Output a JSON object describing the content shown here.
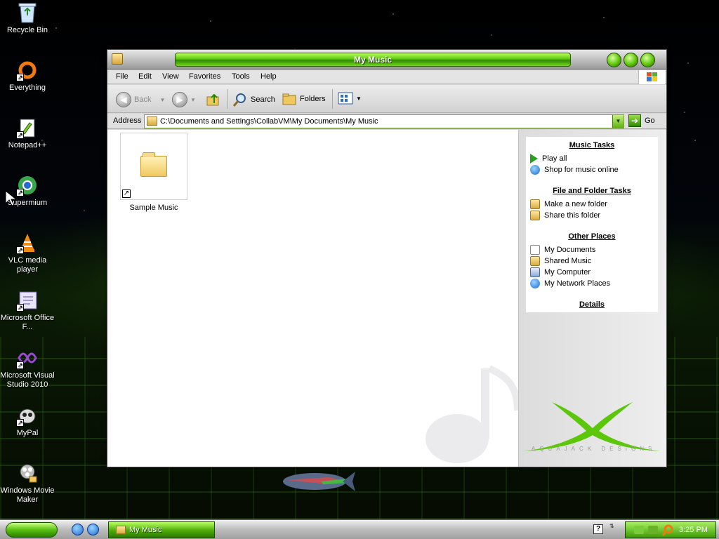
{
  "desktop": {
    "icons": [
      {
        "label": "Recycle Bin",
        "icon": "recycle-bin-icon"
      },
      {
        "label": "Everything",
        "icon": "everything-icon"
      },
      {
        "label": "Notepad++",
        "icon": "notepad-icon"
      },
      {
        "label": "Supermium",
        "icon": "browser-icon"
      },
      {
        "label": "VLC media player",
        "icon": "vlc-icon"
      },
      {
        "label": "Microsoft Office F...",
        "icon": "office-icon"
      },
      {
        "label": "Microsoft Visual Studio 2010",
        "icon": "visual-studio-icon"
      },
      {
        "label": "MyPal",
        "icon": "mypal-icon"
      },
      {
        "label": "Windows Movie Maker",
        "icon": "movie-maker-icon"
      }
    ]
  },
  "window": {
    "title": "My Music",
    "menu": [
      "File",
      "Edit",
      "View",
      "Favorites",
      "Tools",
      "Help"
    ],
    "toolbar": {
      "back": "Back",
      "search": "Search",
      "folders": "Folders"
    },
    "address": {
      "label": "Address",
      "value": "C:\\Documents and Settings\\CollabVM\\My Documents\\My Music",
      "go": "Go"
    },
    "files": [
      {
        "name": "Sample Music",
        "type": "folder-shortcut"
      }
    ],
    "taskpane": {
      "sections": [
        {
          "title": "Music Tasks",
          "links": [
            "Play all",
            "Shop for music online"
          ]
        },
        {
          "title": "File and Folder Tasks",
          "links": [
            "Make a new folder",
            "Share this folder"
          ]
        },
        {
          "title": "Other Places",
          "links": [
            "My Documents",
            "Shared Music",
            "My Computer",
            "My Network Places"
          ]
        },
        {
          "title": "Details",
          "links": []
        }
      ],
      "brand": "AQUAJACK DESIGNS"
    }
  },
  "taskbar": {
    "task_label": "My Music",
    "clock": "3:25 PM"
  },
  "colors": {
    "accent_green": "#5cc60a",
    "dark_green": "#2c8000"
  }
}
